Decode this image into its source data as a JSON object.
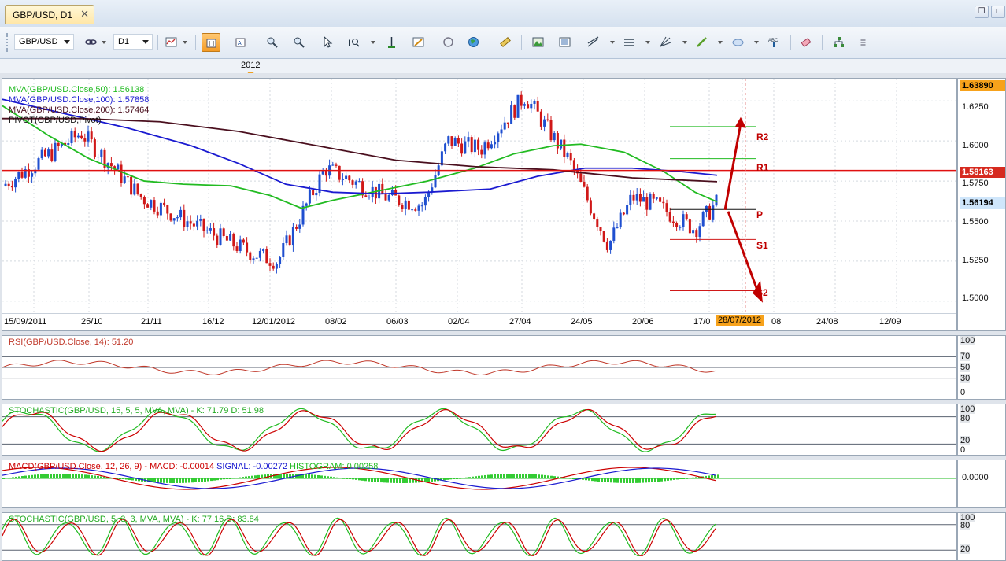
{
  "window": {
    "tab_title": "GBP/USD, D1",
    "tab_close": "✕",
    "restore_glyph": "❐",
    "maximize_glyph": "□"
  },
  "toolbar": {
    "symbol": "GBP/USD",
    "timeframe": "D1",
    "buttons": [
      "chart-type-icon",
      "bar-chart-icon",
      "candle-chart-icon",
      "zoom-in-icon",
      "zoom-out-icon",
      "cursor-icon",
      "zoom-area-icon",
      "period-separator-icon",
      "draw-tools-icon",
      "grid-icon",
      "globe-icon",
      "ruler-icon",
      "screenshot-icon",
      "template-icon",
      "trendline-icon",
      "horizontal-line-icon",
      "fibonacci-icon",
      "pencil-icon",
      "ellipse-icon",
      "text-label-icon",
      "eraser-icon",
      "object-tree-icon"
    ]
  },
  "timebar": {
    "year_marker": "2012"
  },
  "main_chart": {
    "legend": [
      {
        "text": "MVA(GBP/USD.Close,50): 1.56138",
        "color": "#22bb22"
      },
      {
        "text": "MVA(GBP/USD.Close,100): 1.57858",
        "color": "#1a1ad0"
      },
      {
        "text": "MVA(GBP/USD.Close,200): 1.57464",
        "color": "#4a0f1e"
      },
      {
        "text": "PIVOT(GBP/USD,Pivot)",
        "color": "#111111"
      }
    ],
    "y_ticks": [
      "1.6250",
      "1.6000",
      "1.5750",
      "1.5500",
      "1.5250",
      "1.5000"
    ],
    "y_tags": {
      "top": "1.63890",
      "resistance": "1.58163",
      "current": "1.56194"
    },
    "x_ticks": [
      "15/09/2011",
      "25/10",
      "21/11",
      "16/12",
      "12/01/2012",
      "08/02",
      "06/03",
      "02/04",
      "27/04",
      "24/05",
      "20/06",
      "17/0",
      "08",
      "24/08",
      "12/09"
    ],
    "x_highlight": "28/07/2012",
    "pivot_levels": [
      "R2",
      "R1",
      "P",
      "S1",
      "S2"
    ]
  },
  "chart_data": {
    "type": "candlestick",
    "instrument": "GBP/USD",
    "timeframe": "D1",
    "y_range": [
      1.4925,
      1.6389
    ],
    "horizontal_line": 1.58163,
    "last_close": 1.56194,
    "moving_averages": [
      {
        "name": "MVA(GBP/USD.Close,50)",
        "last": 1.56138
      },
      {
        "name": "MVA(GBP/USD.Close,100)",
        "last": 1.57858
      },
      {
        "name": "MVA(GBP/USD.Close,200)",
        "last": 1.57464
      }
    ],
    "pivots": {
      "R2": 1.609,
      "R1": 1.589,
      "P": 1.5575,
      "S1": 1.5385,
      "S2": 1.5065
    },
    "close_path": [
      [
        "15/09/2011",
        1.572
      ],
      [
        "25/10",
        1.605
      ],
      [
        "21/11",
        1.565
      ],
      [
        "16/12",
        1.545
      ],
      [
        "12/01/2012",
        1.53
      ],
      [
        "08/02",
        1.583
      ],
      [
        "06/03",
        1.565
      ],
      [
        "02/04",
        1.6
      ],
      [
        "27/04",
        1.628
      ],
      [
        "24/05",
        1.573
      ],
      [
        "20/06",
        1.56
      ],
      [
        "17/07",
        1.552
      ],
      [
        "28/07",
        1.5619
      ]
    ]
  },
  "indicators": [
    {
      "label": "RSI(GBP/USD.Close, 14): 51.20",
      "color": "#c0392b",
      "levels": [
        "100",
        "70",
        "50",
        "30",
        "0"
      ]
    },
    {
      "label": "STOCHASTIC(GBP/USD, 15, 5, 5, MVA, MVA)  -  K: 71.79   D: 51.98",
      "color": "#22bb22",
      "levels": [
        "100",
        "80",
        "20",
        "0"
      ]
    },
    {
      "label_parts": [
        {
          "text": "MACD(GBP/USD.Close, 12, 26, 9)  -  MACD: -0.00014",
          "color": "#cc0000"
        },
        {
          "text": "  SIGNAL: -0.00272",
          "color": "#1a1ad0"
        },
        {
          "text": "  HISTOGRAM: 0.00258",
          "color": "#22bb22"
        }
      ],
      "levels": [
        "0.0000"
      ]
    },
    {
      "label": "STOCHASTIC(GBP/USD, 5, 3, 3, MVA, MVA)  -  K: 77.16   D: 83.84",
      "color": "#22bb22",
      "levels": [
        "100",
        "80",
        "20"
      ]
    }
  ]
}
